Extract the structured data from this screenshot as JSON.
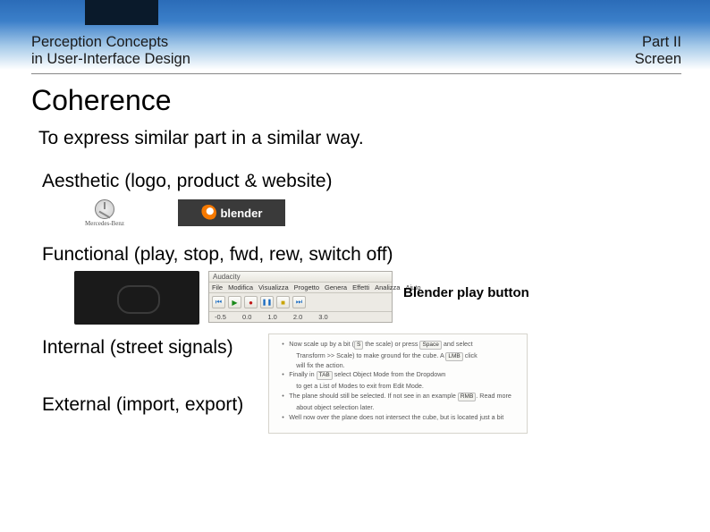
{
  "header": {
    "left_line1": "Perception Concepts",
    "left_line2": "in User-Interface Design",
    "right_line1": "Part II",
    "right_line2": "Screen"
  },
  "title": "Coherence",
  "subtitle": "To express similar part in a similar way.",
  "sections": {
    "aesthetic": "Aesthetic (logo, product & website)",
    "functional": "Functional (play, stop, fwd, rew, switch off)",
    "internal": "Internal (street signals)",
    "external": "External (import, export)"
  },
  "logos": {
    "mb_label": "Mercedes-Benz",
    "blender_label": "blender"
  },
  "toolbar": {
    "window_title": "Audacity",
    "menu": [
      "File",
      "Modifica",
      "Visualizza",
      "Progetto",
      "Genera",
      "Effetti",
      "Analizza",
      "Aiuto"
    ],
    "play_glyph": "▶",
    "stop_glyph": "■",
    "rec_glyph": "●",
    "skip_start_glyph": "⏮",
    "skip_end_glyph": "⏭",
    "pause_glyph": "❚❚",
    "scale": [
      "-0.5",
      "0.0",
      "1.0",
      "2.0",
      "3.0"
    ]
  },
  "play_label": "Blender play button",
  "doc_panel": {
    "line1_a": "Now scale up by a bit (",
    "line1_key1": "S",
    "line1_b": " the scale) or press ",
    "line1_key2": "Space",
    "line1_c": " and select",
    "line2_a": "Transform >> Scale) to make ground for the cube. A ",
    "line2_key": "LMB",
    "line2_b": " click",
    "line3": "will fix the action.",
    "line4_a": "Finally in ",
    "line4_key": "TAB",
    "line4_b": " select Object Mode from the Dropdown",
    "line5": "to get a List of Modes to exit from Edit Mode.",
    "line6": "The plane should still be selected. If not see in an example ",
    "line6_key": "RMB",
    "line6_b": ". Read more",
    "line7": "about object selection later.",
    "line8": "Well now over the plane does not intersect the cube, but is located just a bit"
  }
}
